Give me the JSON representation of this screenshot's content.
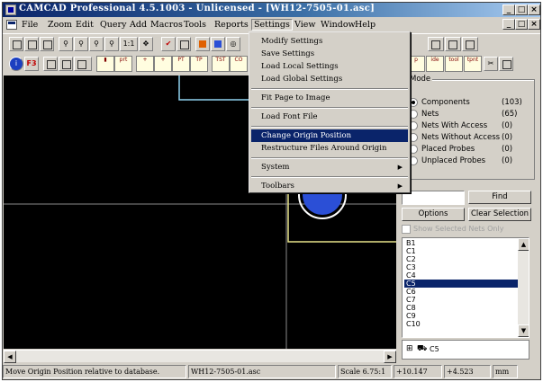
{
  "window": {
    "title": "CAMCAD Professional 4.5.1003 - Unlicensed - [WH12-7505-01.asc]",
    "minimize": "_",
    "restore": "□",
    "close": "×"
  },
  "menubar": {
    "items": [
      "File",
      "Zoom",
      "Edit",
      "Query",
      "Add",
      "Macros",
      "Tools",
      "Reports",
      "Settings",
      "View",
      "Window",
      "Help"
    ],
    "open_item": "Settings"
  },
  "toolbar": {
    "row1": [
      "save-icon",
      "print-icon",
      "open-icon",
      "zoom-in-icon",
      "zoom-out-icon",
      "zoom-window-icon",
      "zoom-extents-icon",
      "1:1",
      "pan-icon",
      "redraw-icon",
      "query-icon",
      "layer-icon",
      "color-icon",
      "snap-icon"
    ],
    "row2_labels": [
      "F3",
      "prt",
      "+",
      "+",
      "PT",
      "TP",
      "TST",
      "CO",
      "EXT"
    ],
    "right_labels": [
      "p",
      "ide",
      "tool",
      "tpnt",
      "cut-icon",
      "copy-icon"
    ]
  },
  "settings_menu": {
    "items": [
      {
        "label": "Modify Settings",
        "highlighted": false,
        "submenu": false
      },
      {
        "label": "Save Settings",
        "highlighted": false,
        "submenu": false
      },
      {
        "label": "Load Local Settings",
        "highlighted": false,
        "submenu": false
      },
      {
        "label": "Load Global Settings",
        "highlighted": false,
        "submenu": false
      },
      {
        "label": "Fit Page to Image",
        "highlighted": false,
        "submenu": false
      },
      {
        "label": "Load Font File",
        "highlighted": false,
        "submenu": false
      },
      {
        "label": "Change Origin Position",
        "highlighted": true,
        "submenu": false
      },
      {
        "label": "Restructure Files Around Origin",
        "highlighted": false,
        "submenu": false
      },
      {
        "label": "System",
        "highlighted": false,
        "submenu": true
      },
      {
        "label": "Toolbars",
        "highlighted": false,
        "submenu": true
      }
    ]
  },
  "panel": {
    "mode_label": "Mode",
    "modes": [
      {
        "label": "Components",
        "count": "(103)",
        "selected": true
      },
      {
        "label": "Nets",
        "count": "(65)",
        "selected": false
      },
      {
        "label": "Nets With Access",
        "count": "(0)",
        "selected": false
      },
      {
        "label": "Nets Without Access",
        "count": "(0)",
        "selected": false
      },
      {
        "label": "Placed Probes",
        "count": "(0)",
        "selected": false
      },
      {
        "label": "Unplaced Probes",
        "count": "(0)",
        "selected": false
      }
    ],
    "find_value": "",
    "find_button": "Find",
    "options_button": "Options",
    "clear_selection_button": "Clear Selection",
    "show_selected_nets_only": "Show Selected Nets Only",
    "list_items": [
      "B1",
      "C1",
      "C2",
      "C3",
      "C4",
      "C5",
      "C6",
      "C7",
      "C8",
      "C9",
      "C10"
    ],
    "list_selected": "C5",
    "tree_expander": "⊞",
    "tree_item": "C5"
  },
  "status": {
    "message": "Move Origin Position relative to database.",
    "file": "WH12-7505-01.asc",
    "scale": "Scale 6.75:1",
    "x": "+10.147",
    "y": "+4.523",
    "units": "mm"
  },
  "colors": {
    "title_start": "#0a246a",
    "highlight": "#0a246a",
    "board_outline": "#e8e48a",
    "pad_blue": "#2b4fd6",
    "canvas": "#000000"
  }
}
